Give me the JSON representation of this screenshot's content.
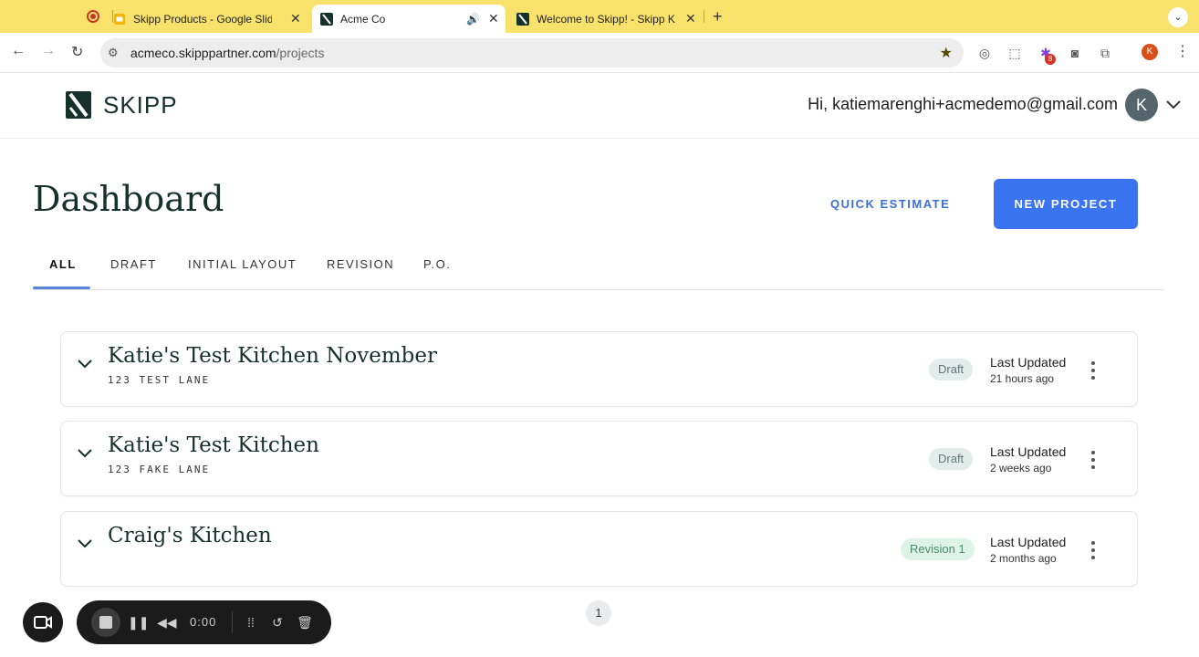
{
  "browser": {
    "tabs": [
      {
        "title": "Skipp Products - Google Slide",
        "active": false
      },
      {
        "title": "Acme Co",
        "active": true
      },
      {
        "title": "Welcome to Skipp! - Skipp Kn",
        "active": false
      }
    ],
    "new_tab_glyph": "+",
    "address": {
      "host": "acmeco.skipppartner.com",
      "path": "/projects"
    },
    "extension_badge": "8",
    "profile_initial": "K"
  },
  "app": {
    "brand": "SKIPP",
    "greeting": "Hi, katiemarenghi+acmedemo@gmail.com",
    "avatar_initial": "K"
  },
  "dashboard": {
    "title": "Dashboard",
    "quick_estimate_label": "QUICK ESTIMATE",
    "new_project_label": "NEW PROJECT",
    "tabs": [
      "ALL",
      "DRAFT",
      "INITIAL LAYOUT",
      "REVISION",
      "P.O."
    ],
    "active_tab": "ALL",
    "projects": [
      {
        "name": "Katie's Test Kitchen November",
        "address": "123 TEST LANE",
        "status": "Draft",
        "last_updated_label": "Last Updated",
        "last_updated": "21 hours ago"
      },
      {
        "name": "Katie's Test Kitchen",
        "address": "123 FAKE LANE",
        "status": "Draft",
        "last_updated_label": "Last Updated",
        "last_updated": "2 weeks ago"
      },
      {
        "name": "Craig's Kitchen",
        "address": "",
        "status": "Revision 1",
        "last_updated_label": "Last Updated",
        "last_updated": "2 months ago"
      }
    ],
    "current_page": "1"
  },
  "recorder": {
    "time": "0:00"
  },
  "colors": {
    "primary": "#3b74f0",
    "link": "#3b6fd6",
    "heading": "#16302b",
    "tabstrip": "#f9e26b"
  }
}
